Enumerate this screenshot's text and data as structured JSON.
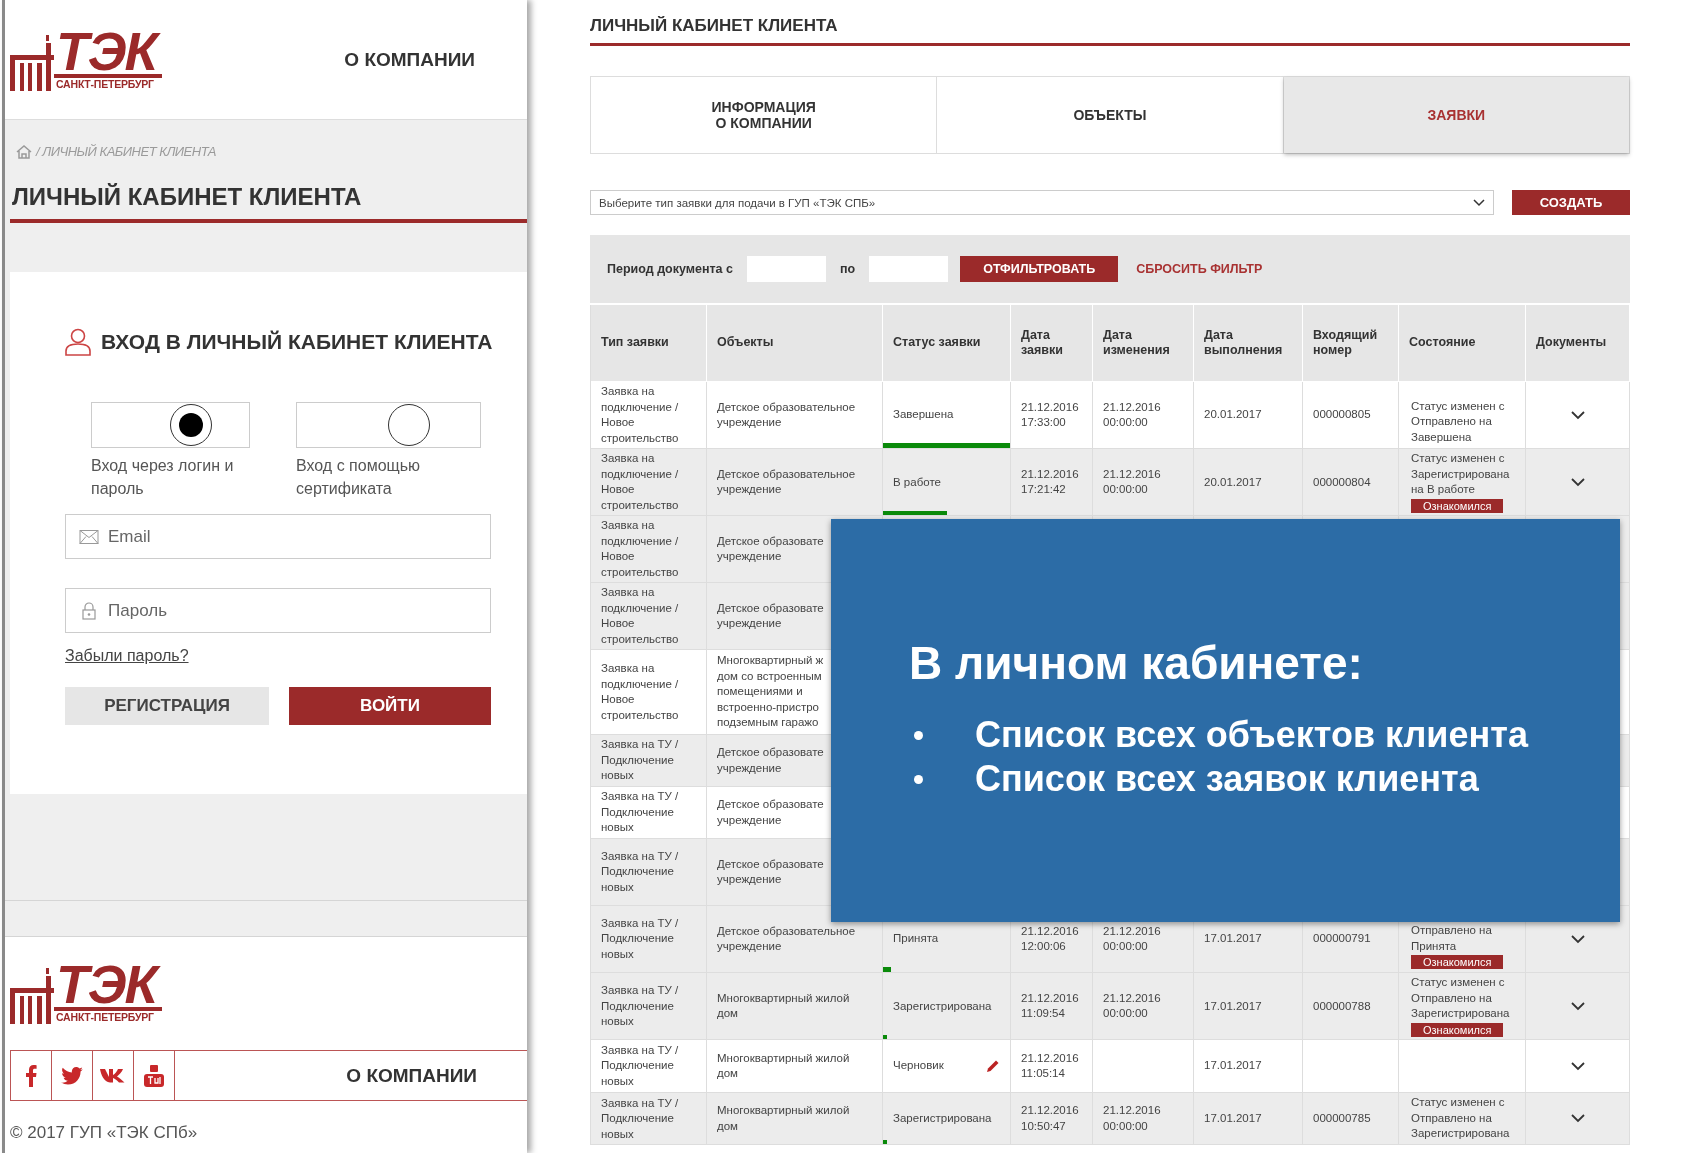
{
  "login_screen": {
    "logo": {
      "name": "ТЭК",
      "city": "САНКТ-ПЕТЕРБУРГ"
    },
    "nav_link": "О КОМПАНИИ",
    "breadcrumb": "/ ЛИЧНЫЙ КАБИНЕТ КЛИЕНТА",
    "title": "ЛИЧНЫЙ КАБИНЕТ КЛИЕНТА",
    "login_form": {
      "heading": "ВХОД В ЛИЧНЫЙ КАБИНЕТ КЛИЕНТА",
      "methods": [
        {
          "label": "Вход через логин и пароль",
          "selected": true
        },
        {
          "label": "Вход с помощью сертификата",
          "selected": false
        }
      ],
      "email": {
        "placeholder": "Email"
      },
      "password": {
        "placeholder": "Пароль"
      },
      "forgot_link": "Забыли пароль?",
      "buttons": [
        {
          "label": "РЕГИСТРАЦИЯ",
          "kind": "secondary"
        },
        {
          "label": "ВОЙТИ",
          "kind": "primary"
        }
      ]
    },
    "footer": {
      "logo": {
        "name": "ТЭК",
        "city": "САНКТ-ПЕТЕРБУРГ"
      },
      "nav_link": "О КОМПАНИИ",
      "copyright": "© 2017 ГУП «ТЭК СПб»"
    }
  },
  "cabinet_screen": {
    "title": "ЛИЧНЫЙ КАБИНЕТ КЛИЕНТА",
    "tabs": [
      {
        "label": "ИНФОРМАЦИЯ\nО КОМПАНИИ",
        "selected": false
      },
      {
        "label": "ОБЪЕКТЫ",
        "selected": false
      },
      {
        "label": "ЗАЯВКИ",
        "selected": true
      }
    ],
    "request_type_select": {
      "prompt": "Выберите тип заявки для подачи в ГУП «ТЭК СПБ»"
    },
    "create_button": "СОЗДАТЬ",
    "filter": {
      "label": "Период документа с",
      "to_label": "по",
      "apply_button": "ОТФИЛЬТРОВАТЬ",
      "reset_link": "СБРОСИТЬ ФИЛЬТР"
    },
    "table": {
      "columns": [
        "Тип заявки",
        "Объекты",
        "Статус заявки",
        "Дата заявки",
        "Дата изменения",
        "Дата выполнения",
        "Входящий номер",
        "Состояние",
        "Документы"
      ],
      "rows": [
        {
          "kind": "full",
          "type": "Заявка на подключение / Новое строительство",
          "object": "Детское образовательное учреждение",
          "status": "Завершена",
          "level": 1,
          "editable": false,
          "requested": "21.12.2016 17:33:00",
          "changed": "21.12.2016 00:00:00",
          "completed": "20.01.2017",
          "number": "000000805",
          "state": "Статус изменен с Отправлено на Завершена"
        },
        {
          "kind": "full",
          "type": "Заявка на подключение / Новое строительство",
          "object": "Детское образовательное учреждение",
          "status": "В работе",
          "level": 0.5,
          "editable": false,
          "requested": "21.12.2016 17:21:42",
          "changed": "21.12.2016 00:00:00",
          "completed": "20.01.2017",
          "number": "000000804",
          "state": "Статус изменен с Зарегистрирована на В работе",
          "badge": "Ознакомился"
        },
        {
          "kind": "covered",
          "type": "Заявка на подключение / Новое строительство",
          "object": "Детское образовате\nучреждение"
        },
        {
          "kind": "covered",
          "type": "Заявка на подключение / Новое строительство",
          "object": "Детское образовате\nучреждение"
        },
        {
          "kind": "covered",
          "type": "Заявка на подключение / Новое строительство",
          "object": "Многоквартирный ж\nдом со встроенным\nпомещениями и\nвстроенно-пристро\nподземным гаражо"
        },
        {
          "kind": "covered",
          "type": "Заявка на ТУ / Подключение новых",
          "object": "Детское образовате\nучреждение"
        },
        {
          "kind": "covered",
          "type": "Заявка на ТУ / Подключение новых",
          "object": "Детское образовате\nучреждение"
        },
        {
          "kind": "covered",
          "type": "Заявка на ТУ / Подключение новых",
          "object": "Детское образовате\nучреждение"
        },
        {
          "kind": "full",
          "type": "Заявка на ТУ / Подключение новых",
          "object": "Детское образовательное учреждение",
          "status": "Принята",
          "level": 0.06,
          "editable": false,
          "requested": "21.12.2016 12:00:06",
          "changed": "21.12.2016 00:00:00",
          "completed": "17.01.2017",
          "number": "000000791",
          "state": "Отправлено на Принята",
          "badge": "Ознакомился"
        },
        {
          "kind": "full",
          "type": "Заявка на ТУ / Подключение новых",
          "object": "Многоквартирный жилой дом",
          "status": "Зарегистрирована",
          "level": 0.03,
          "editable": false,
          "requested": "21.12.2016 11:09:54",
          "changed": "21.12.2016 00:00:00",
          "completed": "17.01.2017",
          "number": "000000788",
          "state": "Статус изменен с Отправлено на Зарегистрирована",
          "badge": "Ознакомился"
        },
        {
          "kind": "full",
          "type": "Заявка на ТУ / Подключение новых",
          "object": "Многоквартирный жилой дом",
          "status": "Черновик",
          "editable": true,
          "requested": "21.12.2016 11:05:14",
          "completed": "17.01.2017"
        },
        {
          "kind": "full",
          "type": "Заявка на ТУ / Подключение новых",
          "object": "Многоквартирный жилой дом",
          "status": "Зарегистрирована",
          "level": 0.03,
          "editable": false,
          "requested": "21.12.2016 10:50:47",
          "changed": "21.12.2016 00:00:00",
          "completed": "17.01.2017",
          "number": "000000785",
          "state": "Статус изменен с Отправлено на Зарегистрирована"
        }
      ]
    }
  },
  "overlay": {
    "heading": "В личном кабинете:",
    "bullets": [
      "Список всех объектов клиента",
      "Список всех заявок клиента"
    ]
  }
}
